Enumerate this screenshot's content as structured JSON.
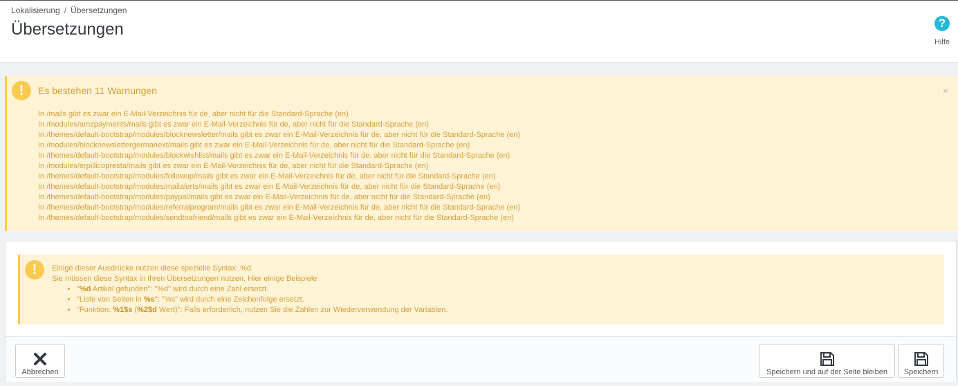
{
  "breadcrumb": {
    "parent": "Lokalisierung",
    "separator": "/",
    "current": "Übersetzungen"
  },
  "page_title": "Übersetzungen",
  "help": {
    "label": "Hilfe",
    "icon": "question-circle-icon",
    "color": "#25b9d7"
  },
  "warnings": {
    "title": "Es bestehen 11 Warnungen",
    "close_symbol": "×",
    "icon": "exclamation-circle-icon",
    "accent": "#fcc94f",
    "items": [
      "In /mails gibt es zwar ein E-Mail-Verzeichnis für de, aber nicht für die Standard-Sprache (en)",
      "In /modules/amzpayments/mails gibt es zwar ein E-Mail-Verzeichnis für de, aber nicht für die Standard-Sprache (en)",
      "In /themes/default-bootstrap/modules/blocknewsletter/mails gibt es zwar ein E-Mail-Verzeichnis für de, aber nicht für die Standard-Sprache (en)",
      "In /modules/blocknewslettergermanext/mails gibt es zwar ein E-Mail-Verzeichnis für de, aber nicht für die Standard-Sprache (en)",
      "In /themes/default-bootstrap/modules/blockwishlist/mails gibt es zwar ein E-Mail-Verzeichnis für de, aber nicht für die Standard-Sprache (en)",
      "In /modules/erpillicopresta/mails gibt es zwar ein E-Mail-Verzeichnis für de, aber nicht für die Standard-Sprache (en)",
      "In /themes/default-bootstrap/modules/followup/mails gibt es zwar ein E-Mail-Verzeichnis für de, aber nicht für die Standard-Sprache (en)",
      "In /themes/default-bootstrap/modules/mailalerts/mails gibt es zwar ein E-Mail-Verzeichnis für de, aber nicht für die Standard-Sprache (en)",
      "In /themes/default-bootstrap/modules/paypal/mails gibt es zwar ein E-Mail-Verzeichnis für de, aber nicht für die Standard-Sprache (en)",
      "In /themes/default-bootstrap/modules/referralprogram/mails gibt es zwar ein E-Mail-Verzeichnis für de, aber nicht für die Standard-Sprache (en)",
      "In /themes/default-bootstrap/modules/sendtoafriend/mails gibt es zwar ein E-Mail-Verzeichnis für de, aber nicht für die Standard-Sprache (en)"
    ]
  },
  "syntax_info": {
    "line1": "Einige dieser Ausdrücke nutzen diese spezielle Syntax: %d",
    "line2": "Sie müssen diese Syntax in Ihren Übersetzungen nutzen. Hier einige Beispiele",
    "examples": [
      {
        "pre": "\"",
        "bold": "%d",
        "post": " Artikel gefunden\": \"%d\" wird durch eine Zahl ersetzt."
      },
      {
        "pre": "\"Liste von Seiten in ",
        "bold": "%s",
        "post": "\": \"%s\" wird durch eine Zeichenfolge ersetzt."
      },
      {
        "pre": "\"Funktion: ",
        "bold": "%1$s",
        "mid": " (",
        "bold2": "%2$d",
        "post": " Wert)\": Falls erforderlich, nutzen Sie die Zahlen zur Wiederverwendung der Variablen."
      }
    ]
  },
  "footer": {
    "cancel": {
      "label": "Abbrechen",
      "icon": "close-icon"
    },
    "save_stay": {
      "label": "Speichern und auf der Seite bleiben",
      "icon": "floppy-disk-icon"
    },
    "save": {
      "label": "Speichern",
      "icon": "floppy-disk-icon"
    }
  }
}
